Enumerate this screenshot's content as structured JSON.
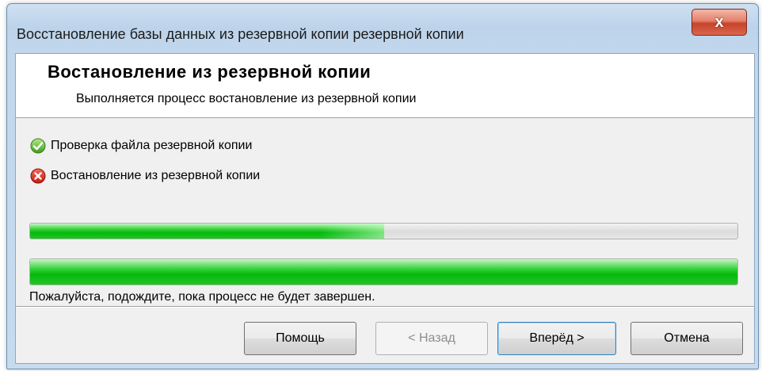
{
  "window": {
    "title": "Восстановление базы данных из резервной копии резервной копии",
    "close_label": "x"
  },
  "header": {
    "title": "Востановление из резервной копии",
    "subtitle": "Выполняется процесс востановление из резервной копии"
  },
  "steps": [
    {
      "label": "Проверка файла резервной копии",
      "status": "success",
      "icon": "check-icon"
    },
    {
      "label": "Востановление из резервной копии",
      "status": "error",
      "icon": "error-icon"
    }
  ],
  "progress": {
    "current_step_fraction": 0.5,
    "overall_fraction": 1.0
  },
  "status_text": "Пожалуйста, подождите, пока процесс не будет завершен.",
  "buttons": {
    "help": "Помощь",
    "back": "< Назад",
    "next": "Вперёд >",
    "cancel": "Отмена"
  },
  "colors": {
    "progress_green": "#06b80c",
    "close_red": "#c9432a"
  }
}
